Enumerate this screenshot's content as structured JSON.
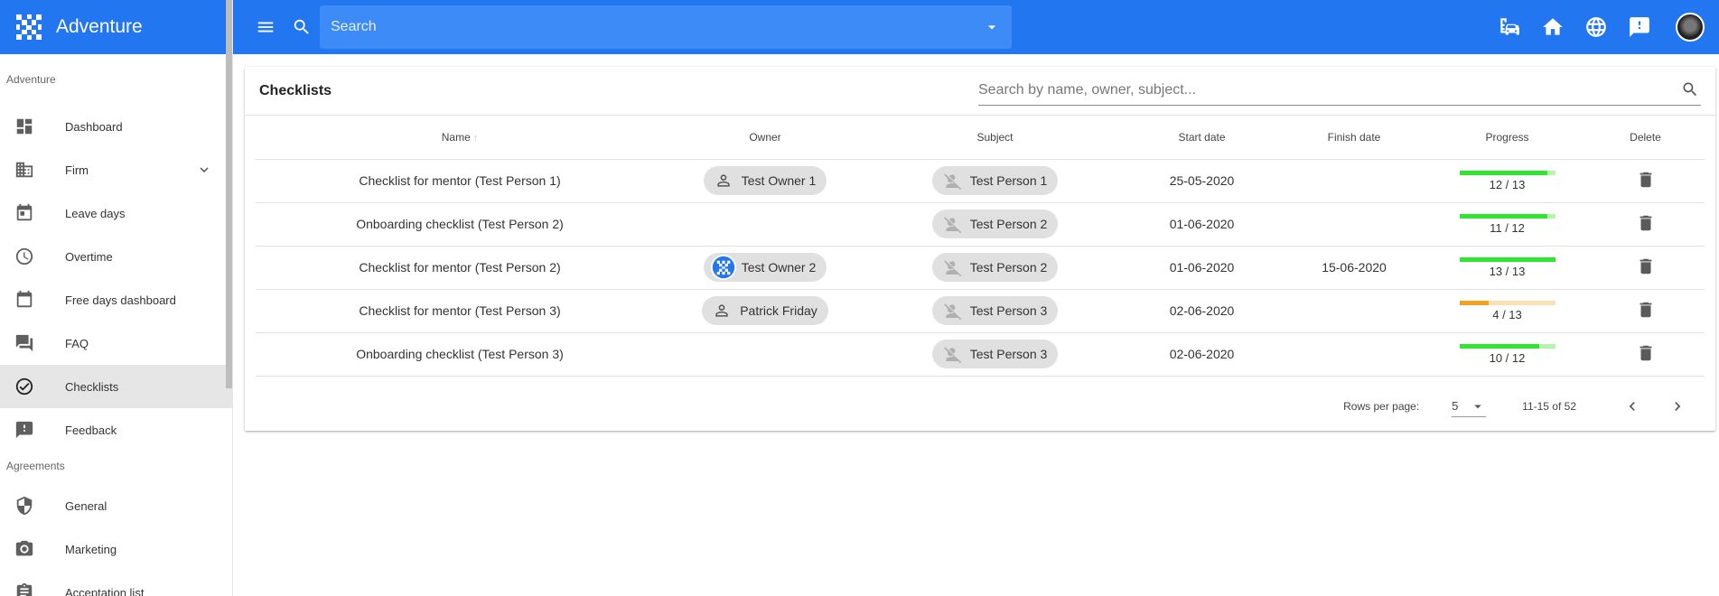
{
  "app": {
    "title": "Adventure",
    "brand_color": "#2276f0"
  },
  "topbar": {
    "search_placeholder": "Search",
    "actions": [
      "company-car-icon",
      "home-icon",
      "globe-icon",
      "feedback-icon",
      "user-avatar"
    ]
  },
  "sidebar": {
    "sections": [
      {
        "label": "Adventure",
        "items": [
          {
            "label": "Dashboard",
            "icon": "dashboard-icon"
          },
          {
            "label": "Firm",
            "icon": "building-icon",
            "expandable": true
          },
          {
            "label": "Leave days",
            "icon": "calendar-icon"
          },
          {
            "label": "Overtime",
            "icon": "clock-icon"
          },
          {
            "label": "Free days dashboard",
            "icon": "calendar-blank-icon"
          },
          {
            "label": "FAQ",
            "icon": "forum-icon"
          },
          {
            "label": "Checklists",
            "icon": "check-circle-icon",
            "active": true
          },
          {
            "label": "Feedback",
            "icon": "feedback-icon"
          }
        ]
      },
      {
        "label": "Agreements",
        "items": [
          {
            "label": "General",
            "icon": "shield-icon"
          },
          {
            "label": "Marketing",
            "icon": "camera-icon"
          },
          {
            "label": "Acceptation list",
            "icon": "clipboard-icon"
          }
        ]
      }
    ]
  },
  "card": {
    "title": "Checklists",
    "filter_placeholder": "Search by name, owner, subject...",
    "columns": [
      "Name",
      "Owner",
      "Subject",
      "Start date",
      "Finish date",
      "Progress",
      "Delete"
    ],
    "rows": [
      {
        "name": "Checklist for mentor (Test Person 1)",
        "owner": "Test Owner 1",
        "owner_icon": "person-icon",
        "subject": "Test Person 1",
        "start": "25-05-2020",
        "finish": "",
        "progress": "12 / 13",
        "done": 12,
        "total": 13,
        "status": "ok"
      },
      {
        "name": "Onboarding checklist (Test Person 2)",
        "owner": "",
        "owner_icon": "",
        "subject": "Test Person 2",
        "start": "01-06-2020",
        "finish": "",
        "progress": "11 / 12",
        "done": 11,
        "total": 12,
        "status": "ok"
      },
      {
        "name": "Checklist for mentor (Test Person 2)",
        "owner": "Test Owner 2",
        "owner_icon": "logo-avatar",
        "subject": "Test Person 2",
        "start": "01-06-2020",
        "finish": "15-06-2020",
        "progress": "13 / 13",
        "done": 13,
        "total": 13,
        "status": "ok"
      },
      {
        "name": "Checklist for mentor (Test Person 3)",
        "owner": "Patrick Friday",
        "owner_icon": "person-icon",
        "subject": "Test Person 3",
        "start": "02-06-2020",
        "finish": "",
        "progress": "4 / 13",
        "done": 4,
        "total": 13,
        "status": "warn"
      },
      {
        "name": "Onboarding checklist (Test Person 3)",
        "owner": "",
        "owner_icon": "",
        "subject": "Test Person 3",
        "start": "02-06-2020",
        "finish": "",
        "progress": "10 / 12",
        "done": 10,
        "total": 12,
        "status": "ok"
      }
    ],
    "colors": {
      "ok_fill": "#2ee62e",
      "ok_track": "#b6f5b0",
      "warn_fill": "#f4a020",
      "warn_track": "#fbe0b3"
    }
  },
  "pagination": {
    "rows_per_page_label": "Rows per page:",
    "rows_per_page": "5",
    "range": "11-15 of 52"
  }
}
